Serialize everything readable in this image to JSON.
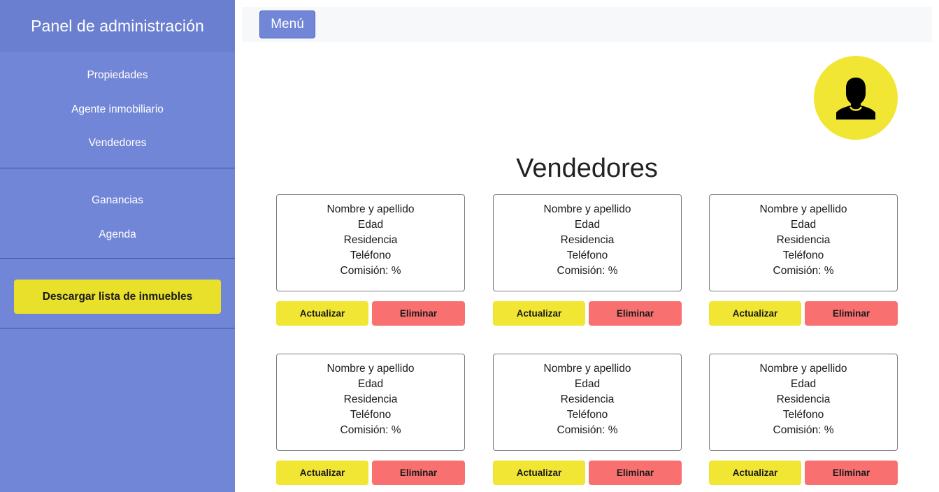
{
  "sidebar": {
    "title": "Panel de administración",
    "group1": [
      "Propiedades",
      "Agente inmobiliario",
      "Vendedores"
    ],
    "group2": [
      "Ganancias",
      "Agenda"
    ],
    "download_label": "Descargar lista de inmuebles"
  },
  "topbar": {
    "menu_label": "Menú"
  },
  "main": {
    "title": "Vendedores",
    "cards": [
      {
        "name": "Nombre y apellido",
        "age": "Edad",
        "residence": "Residencia",
        "phone": "Teléfono",
        "commission": "Comisión: %",
        "update_label": "Actualizar",
        "delete_label": "Eliminar"
      },
      {
        "name": "Nombre y apellido",
        "age": "Edad",
        "residence": "Residencia",
        "phone": "Teléfono",
        "commission": "Comisión: %",
        "update_label": "Actualizar",
        "delete_label": "Eliminar"
      },
      {
        "name": "Nombre y apellido",
        "age": "Edad",
        "residence": "Residencia",
        "phone": "Teléfono",
        "commission": "Comisión: %",
        "update_label": "Actualizar",
        "delete_label": "Eliminar"
      },
      {
        "name": "Nombre y apellido",
        "age": "Edad",
        "residence": "Residencia",
        "phone": "Teléfono",
        "commission": "Comisión: %",
        "update_label": "Actualizar",
        "delete_label": "Eliminar"
      },
      {
        "name": "Nombre y apellido",
        "age": "Edad",
        "residence": "Residencia",
        "phone": "Teléfono",
        "commission": "Comisión: %",
        "update_label": "Actualizar",
        "delete_label": "Eliminar"
      },
      {
        "name": "Nombre y apellido",
        "age": "Edad",
        "residence": "Residencia",
        "phone": "Teléfono",
        "commission": "Comisión: %",
        "update_label": "Actualizar",
        "delete_label": "Eliminar"
      }
    ]
  },
  "icons": {
    "avatar": "user-silhouette-icon"
  },
  "colors": {
    "sidebar": "#7186d6",
    "accent_yellow": "#f1e633",
    "danger_red": "#f87070"
  }
}
